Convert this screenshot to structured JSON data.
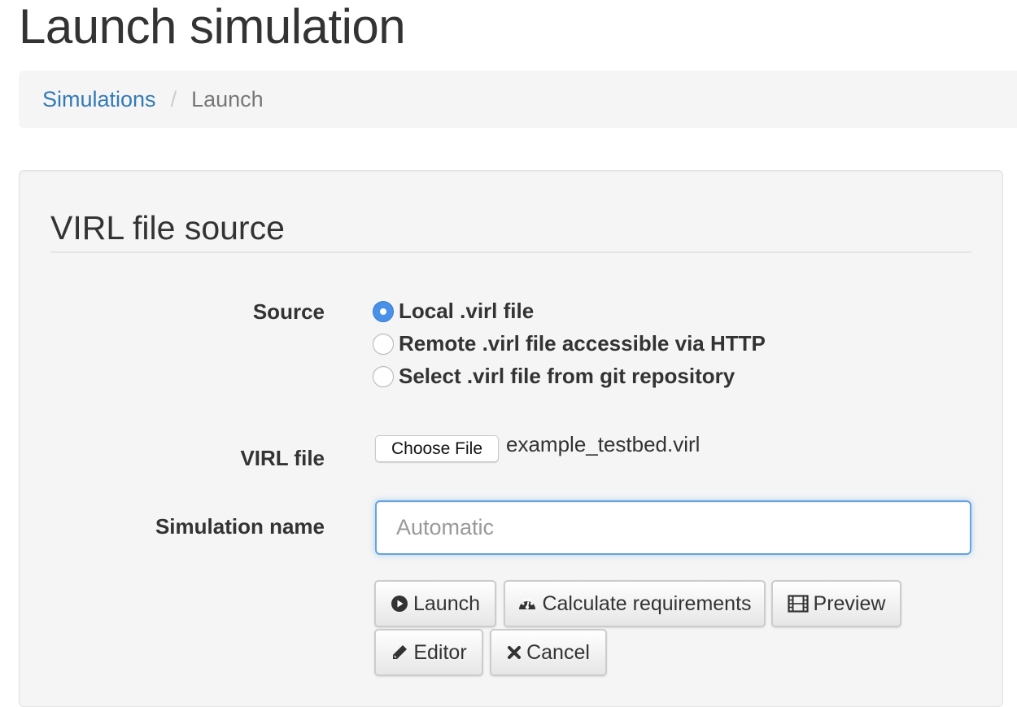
{
  "page": {
    "title": "Launch simulation"
  },
  "breadcrumb": {
    "items": [
      {
        "label": "Simulations",
        "link": true
      },
      {
        "label": "Launch",
        "link": false
      }
    ],
    "separator": "/"
  },
  "form": {
    "legend": "VIRL file source",
    "source": {
      "label": "Source",
      "options": [
        {
          "label": "Local .virl file",
          "checked": true
        },
        {
          "label": "Remote .virl file accessible via HTTP",
          "checked": false
        },
        {
          "label": "Select .virl file from git repository",
          "checked": false
        }
      ]
    },
    "virl_file": {
      "label": "VIRL file",
      "button_label": "Choose File",
      "selected_file": "example_testbed.virl"
    },
    "simulation_name": {
      "label": "Simulation name",
      "value": "",
      "placeholder": "Automatic"
    },
    "buttons": [
      {
        "label": "Launch",
        "icon": "play-circle-icon"
      },
      {
        "label": "Calculate requirements",
        "icon": "dashboard-icon"
      },
      {
        "label": "Preview",
        "icon": "film-icon"
      },
      {
        "label": "Editor",
        "icon": "pencil-icon"
      },
      {
        "label": "Cancel",
        "icon": "close-icon"
      }
    ]
  },
  "colors": {
    "link": "#337ab7",
    "radio_checked": "#4a90e9",
    "focus_border": "#66a3e0"
  }
}
